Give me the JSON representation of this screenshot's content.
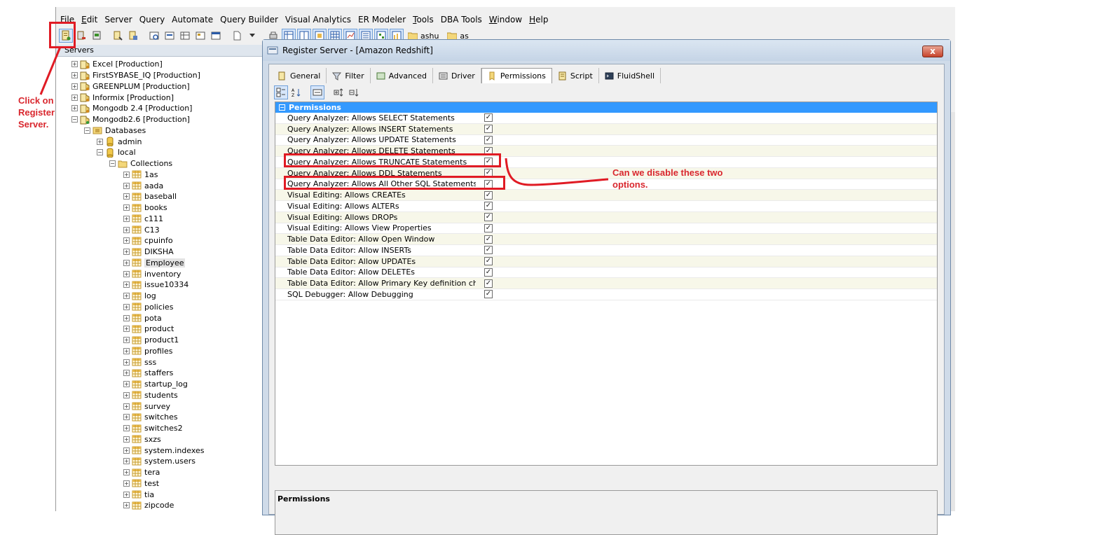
{
  "menu": [
    {
      "label": "File",
      "u": "F",
      "rest": "ile"
    },
    {
      "label": "Edit",
      "u": "E",
      "rest": "dit"
    },
    {
      "label": "Server",
      "u": "",
      "rest": "Server"
    },
    {
      "label": "Query",
      "u": "",
      "rest": "Query"
    },
    {
      "label": "Automate",
      "u": "",
      "rest": "Automate"
    },
    {
      "label": "Query Builder",
      "u": "",
      "rest": "Query Builder"
    },
    {
      "label": "Visual Analytics",
      "u": "",
      "rest": "Visual Analytics"
    },
    {
      "label": "ER Modeler",
      "u": "",
      "rest": "ER Modeler"
    },
    {
      "label": "Tools",
      "u": "T",
      "rest": "ools"
    },
    {
      "label": "DBA Tools",
      "u": "",
      "rest": "DBA Tools"
    },
    {
      "label": "Window",
      "u": "W",
      "rest": "indow"
    },
    {
      "label": "Help",
      "u": "H",
      "rest": "elp"
    }
  ],
  "toolbar": {
    "folders": [
      "ashu",
      "as"
    ]
  },
  "servers_panel": {
    "title": "Servers",
    "servers": [
      "Excel [Production]",
      "FirstSYBASE_IQ [Production]",
      "GREENPLUM [Production]",
      "Informix [Production]",
      "Mongodb 2.4 [Production]",
      "Mongodb2.6 [Production]"
    ],
    "databases_label": "Databases",
    "databases": [
      "admin",
      "local"
    ],
    "collections_label": "Collections",
    "collections": [
      "1as",
      "aada",
      "baseball",
      "books",
      "c111",
      "C13",
      "cpuinfo",
      "DIKSHA",
      "Employee",
      "inventory",
      "issue10334",
      "log",
      "policies",
      "pota",
      "product",
      "product1",
      "profiles",
      "sss",
      "staffers",
      "startup_log",
      "students",
      "survey",
      "switches",
      "switches2",
      "sxzs",
      "system.indexes",
      "system.users",
      "tera",
      "test",
      "tia",
      "zipcode"
    ],
    "selected_collection": "Employee"
  },
  "dialog": {
    "title": "Register Server - [Amazon Redshift]",
    "close_label": "x",
    "tabs": [
      "General",
      "Filter",
      "Advanced",
      "Driver",
      "Permissions",
      "Script",
      "FluidShell"
    ],
    "active_tab": "Permissions",
    "category": "Permissions",
    "permissions": [
      {
        "name": "Query Analyzer: Allows SELECT Statements",
        "checked": true
      },
      {
        "name": "Query Analyzer: Allows INSERT Statements",
        "checked": true
      },
      {
        "name": "Query Analyzer: Allows UPDATE Statements",
        "checked": true
      },
      {
        "name": "Query Analyzer: Allows DELETE Statements",
        "checked": true
      },
      {
        "name": "Query Analyzer: Allows TRUNCATE Statements",
        "checked": true
      },
      {
        "name": "Query Analyzer: Allows DDL Statements",
        "checked": true
      },
      {
        "name": "Query Analyzer: Allows All Other SQL Statements",
        "checked": true
      },
      {
        "name": "Visual Editing: Allows CREATEs",
        "checked": true
      },
      {
        "name": "Visual Editing: Allows ALTERs",
        "checked": true
      },
      {
        "name": "Visual Editing: Allows DROPs",
        "checked": true
      },
      {
        "name": "Visual Editing: Allows View Properties",
        "checked": true
      },
      {
        "name": "Table Data Editor: Allow Open Window",
        "checked": true
      },
      {
        "name": "Table Data Editor: Allow INSERTs",
        "checked": true
      },
      {
        "name": "Table Data Editor: Allow UPDATEs",
        "checked": true
      },
      {
        "name": "Table Data Editor: Allow DELETEs",
        "checked": true
      },
      {
        "name": "Table Data Editor: Allow Primary Key definition changes",
        "checked": true
      },
      {
        "name": "SQL Debugger: Allow Debugging",
        "checked": true
      }
    ],
    "description_title": "Permissions"
  },
  "annotations": {
    "click_register": "Click on Register Server.",
    "question": "Can we disable these two options.",
    "color": "#d9272e"
  }
}
